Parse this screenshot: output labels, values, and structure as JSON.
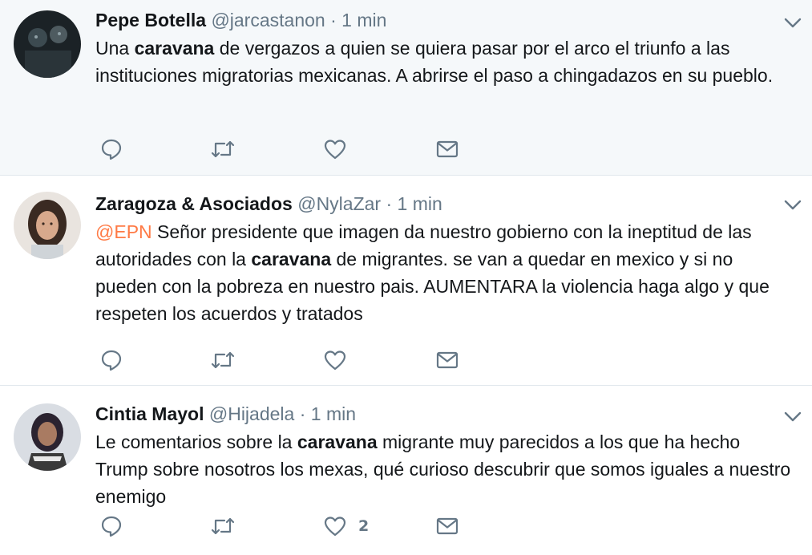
{
  "tweets": [
    {
      "name": "Pepe Botella",
      "handle": "@jarcastanon",
      "separator": "·",
      "time": "1 min",
      "text_before": "Una ",
      "highlight": "caravana",
      "text_after": " de vergazos a quien se quiera pasar por el arco el triunfo a las instituciones migratorias mexicanas. A abrirse el paso a chingadazos en su pueblo.",
      "like_count": ""
    },
    {
      "name": "Zaragoza & Asociados",
      "handle": "@NylaZar",
      "separator": "·",
      "time": "1 min",
      "mention": "@EPN",
      "text_before": " Señor presidente que imagen da nuestro gobierno con la ineptitud de las autoridades con la ",
      "highlight": "caravana",
      "text_after": " de migrantes. se van a quedar en mexico y si no pueden con la pobreza en nuestro pais. AUMENTARA la violencia haga algo y que respeten los acuerdos y tratados",
      "like_count": ""
    },
    {
      "name": "Cintia Mayol",
      "handle": "@Hijadela",
      "separator": "·",
      "time": "1 min",
      "text_before": "Le comentarios sobre la ",
      "highlight": "caravana",
      "text_after": " migrante muy parecidos a los que ha hecho Trump sobre nosotros los mexas, qué curioso descubrir que somos iguales a nuestro enemigo",
      "like_count": "2"
    }
  ],
  "icons": {
    "reply": "reply-icon",
    "retweet": "retweet-icon",
    "like": "heart-icon",
    "message": "envelope-icon",
    "caret": "chevron-down-icon"
  },
  "colors": {
    "highlighted_bg": "#f5f8fa",
    "text": "#14171a",
    "secondary": "#657786",
    "mention": "#ff7a45",
    "divider": "#e1e8ed"
  }
}
